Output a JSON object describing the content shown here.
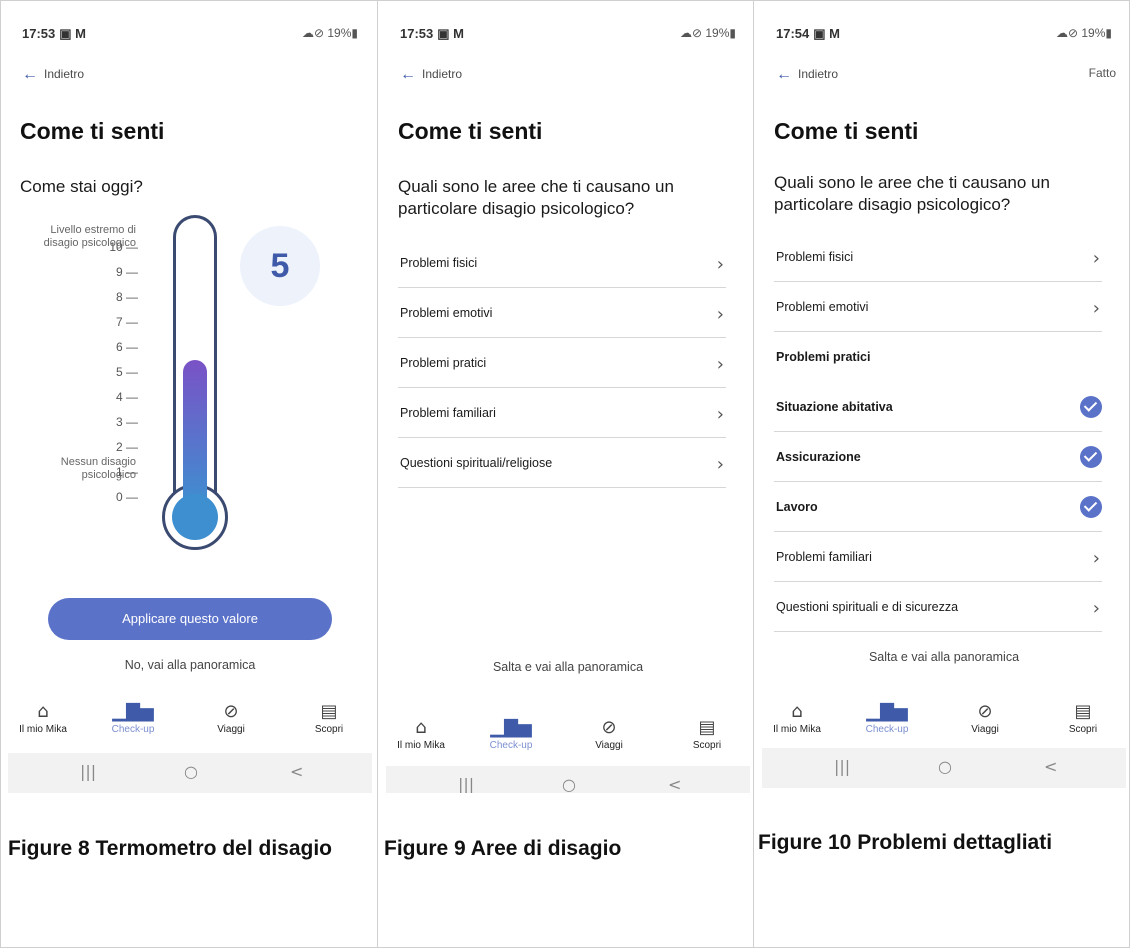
{
  "status": {
    "time1": "17:53",
    "time2": "17:53",
    "time3": "17:54",
    "icons_left": "▣ M",
    "battery": "☁⊘ 19%▮"
  },
  "back_label": "Indietro",
  "done_label": "Fatto",
  "title": "Come ti senti",
  "screen1": {
    "question": "Come stai oggi?",
    "value": "5",
    "top_label": "Livello estremo di disagio psicologico",
    "bottom_label": "Nessun disagio psicologico",
    "ticks": [
      "10 —",
      "9 —",
      "8 —",
      "7 —",
      "6 —",
      "5 —",
      "4 —",
      "3 —",
      "2 —",
      "1 —",
      "0 —"
    ],
    "fill_level": 0.5,
    "apply": "Applicare questo valore",
    "no": "No, vai alla panoramica"
  },
  "screen2": {
    "question": "Quali sono le aree che ti causano un particolare disagio psicologico?",
    "items": [
      "Problemi fisici",
      "Problemi emotivi",
      "Problemi pratici",
      "Problemi familiari",
      "Questioni spirituali/religiose"
    ],
    "skip": "Salta e vai alla panoramica"
  },
  "screen3": {
    "question": "Quali sono le aree che ti causano un particolare disagio psicologico?",
    "items": [
      {
        "label": "Problemi fisici",
        "type": "chevron"
      },
      {
        "label": "Problemi emotivi",
        "type": "chevron"
      },
      {
        "label": "Problemi pratici",
        "type": "header"
      },
      {
        "label": "Situazione abitativa",
        "type": "check"
      },
      {
        "label": "Assicurazione",
        "type": "check"
      },
      {
        "label": "Lavoro",
        "type": "check"
      },
      {
        "label": "Problemi familiari",
        "type": "chevron"
      },
      {
        "label": "Questioni spirituali e di sicurezza",
        "type": "chevron"
      }
    ],
    "skip": "Salta e vai alla panoramica"
  },
  "nav": {
    "home": "Il mio Mika",
    "checkup": "Check-up",
    "trips": "Viaggi",
    "discover": "Scopri",
    "home_icon": "⌂",
    "checkup_icon": "▁▇▅",
    "trips_icon": "⊘",
    "discover_icon": "▤"
  },
  "sysnav": {
    "recent": "|||",
    "home": "○",
    "back": "<"
  },
  "captions": {
    "fig8": "Figure 8 Termometro del disagio",
    "fig9": "Figure 9 Aree di disagio",
    "fig10": "Figure 10 Problemi dettagliati"
  },
  "colors": {
    "accent": "#5b72c9",
    "brand": "#3e5aa8"
  }
}
